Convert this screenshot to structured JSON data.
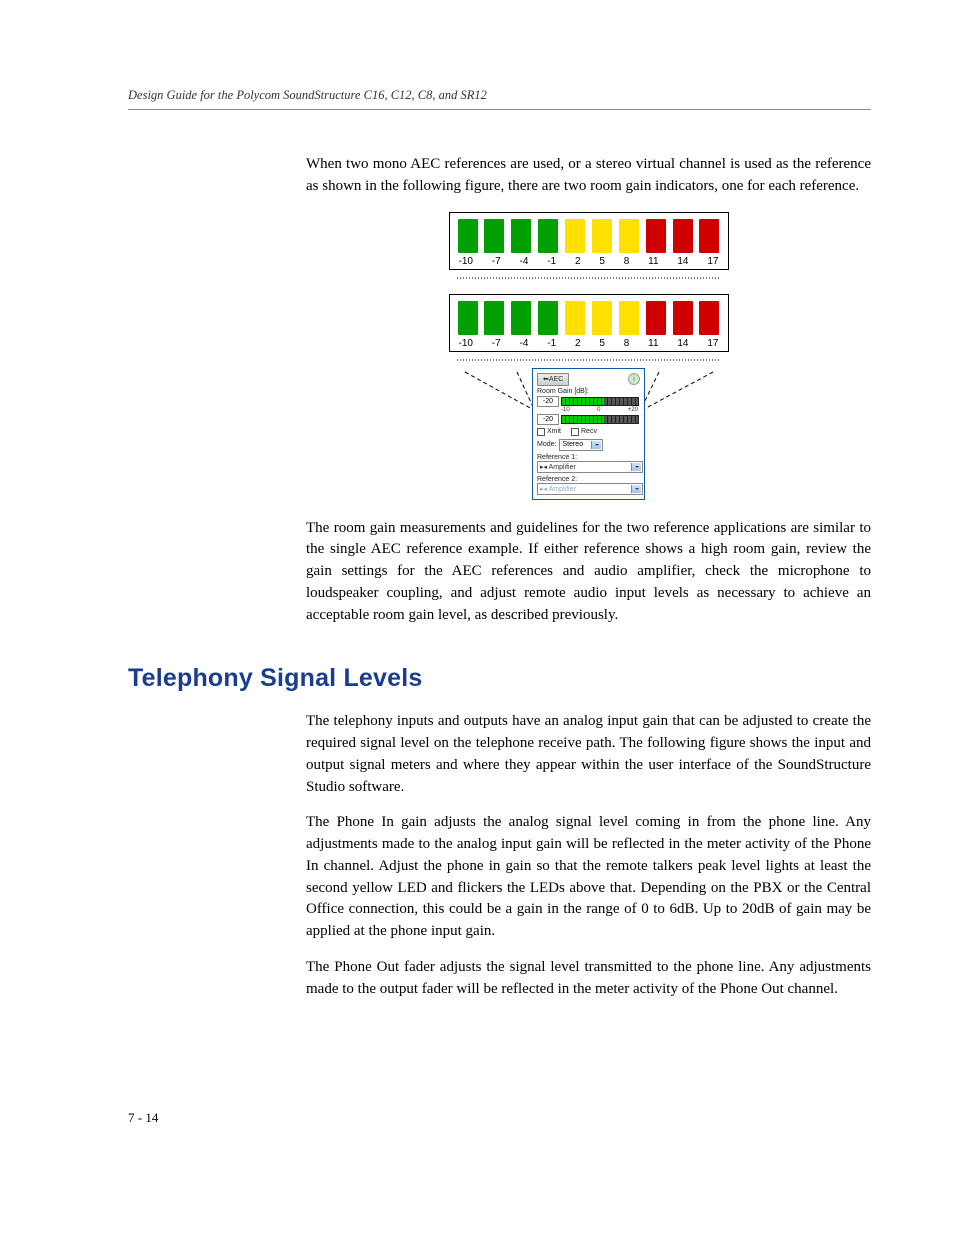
{
  "header": {
    "running": "Design Guide for the Polycom SoundStructure C16, C12, C8, and SR12"
  },
  "body": {
    "p1": "When two mono AEC references are used, or a stereo virtual channel is used as the reference as shown in the following figure, there are two room gain indicators, one for each reference.",
    "p2": "The room gain measurements and guidelines for the two reference applications are similar to the single AEC reference example. If either reference shows a high room gain, review the gain settings for the AEC references and audio amplifier, check the microphone to loudspeaker coupling, and adjust remote audio input levels as necessary to achieve an acceptable room gain level, as described previously.",
    "p3": "The telephony inputs and outputs have an analog input gain that can be adjusted to create the required signal level on the telephone receive path. The following figure shows the input and output signal meters and where they appear within the user interface of the SoundStructure Studio software.",
    "p4": "The Phone In gain adjusts the analog signal level coming in from the phone line. Any adjustments made to the analog input gain will be reflected in the meter activity of the Phone In channel. Adjust the phone in gain so that the remote talkers peak level lights at least the second yellow LED and flickers the LEDs above that. Depending on the PBX or the Central Office connection, this could be a gain in the range of 0 to 6dB. Up to 20dB of gain may be applied at the phone input gain.",
    "p5": "The Phone Out fader adjusts the signal level transmitted to the phone line. Any adjustments made to the output fader will be reflected in the meter activity of the Phone Out channel."
  },
  "section": {
    "telephony": "Telephony Signal Levels"
  },
  "footer": {
    "pagenum": "7 - 14"
  },
  "chart_data": {
    "type": "bar",
    "meters": [
      {
        "ticks": [
          -10,
          -7,
          -4,
          -1,
          2,
          5,
          8,
          11,
          14,
          17
        ],
        "bars": [
          "g",
          "g",
          "g",
          "g",
          "y",
          "y",
          "y",
          "r",
          "r",
          "r"
        ]
      },
      {
        "ticks": [
          -10,
          -7,
          -4,
          -1,
          2,
          5,
          8,
          11,
          14,
          17
        ],
        "bars": [
          "g",
          "g",
          "g",
          "g",
          "y",
          "y",
          "y",
          "r",
          "r",
          "r"
        ]
      }
    ],
    "panel": {
      "aec_label": "AEC",
      "room_gain_label": "Room Gain [dB]:",
      "gain1_value": "-20",
      "gain2_value": "-20",
      "scale_left": "-10",
      "scale_mid": "0",
      "scale_right": "+20",
      "xmit_label": "Xmit",
      "recv_label": "Recv",
      "mode_label": "Mode:",
      "mode_value": "Stereo",
      "ref1_label": "Reference 1:",
      "ref1_value": "▸◂ Amplifier",
      "ref2_label": "Reference 2:",
      "ref2_value": "▸◂ Amplifier"
    }
  }
}
